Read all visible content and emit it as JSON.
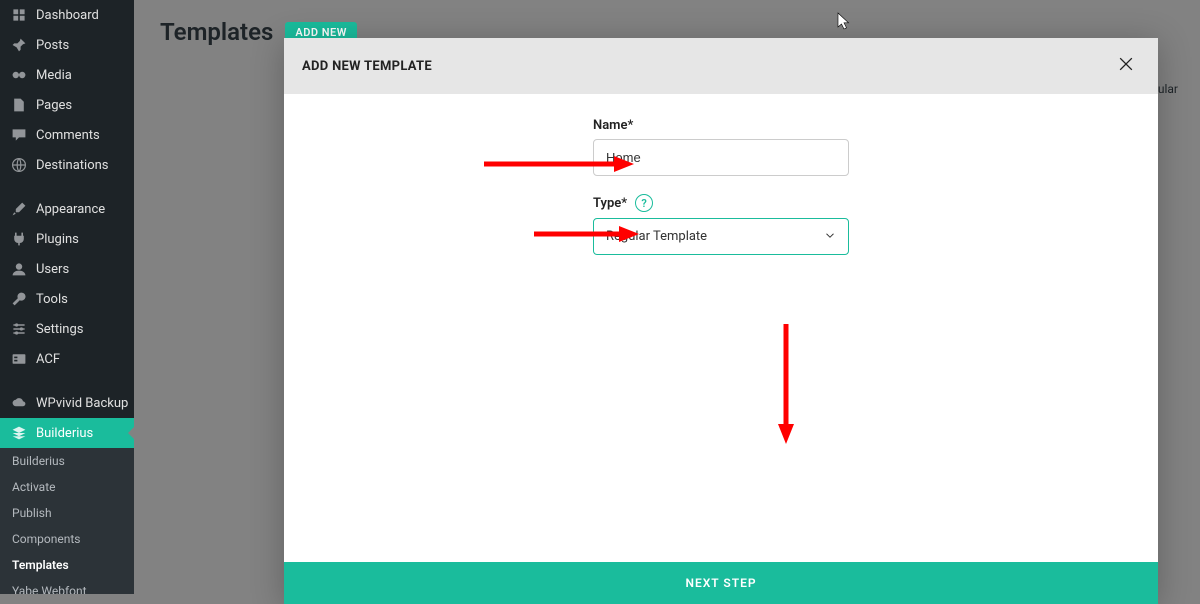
{
  "sidebar": {
    "items": [
      {
        "icon": "dashboard",
        "label": "Dashboard"
      },
      {
        "icon": "pin",
        "label": "Posts"
      },
      {
        "icon": "media",
        "label": "Media"
      },
      {
        "icon": "page",
        "label": "Pages"
      },
      {
        "icon": "comment",
        "label": "Comments"
      },
      {
        "icon": "globe",
        "label": "Destinations"
      },
      {
        "spacer": true
      },
      {
        "icon": "brush",
        "label": "Appearance"
      },
      {
        "icon": "plug",
        "label": "Plugins"
      },
      {
        "icon": "user",
        "label": "Users"
      },
      {
        "icon": "wrench",
        "label": "Tools"
      },
      {
        "icon": "sliders",
        "label": "Settings"
      },
      {
        "icon": "acf",
        "label": "ACF"
      },
      {
        "spacer": true
      },
      {
        "icon": "cloud",
        "label": "WPvivid Backup"
      },
      {
        "icon": "layers",
        "label": "Builderius",
        "active": true
      }
    ],
    "sub": [
      {
        "label": "Builderius"
      },
      {
        "label": "Activate"
      },
      {
        "label": "Publish"
      },
      {
        "label": "Components"
      },
      {
        "label": "Templates",
        "current": true
      },
      {
        "label": "Yabe Webfont"
      }
    ]
  },
  "page": {
    "title": "Templates",
    "add_new": "ADD NEW",
    "corner_text": "ular"
  },
  "modal": {
    "title": "ADD NEW TEMPLATE",
    "name_label": "Name*",
    "name_value": "Home",
    "type_label": "Type*",
    "type_value": "Regular Template",
    "next_button": "NEXT STEP"
  }
}
